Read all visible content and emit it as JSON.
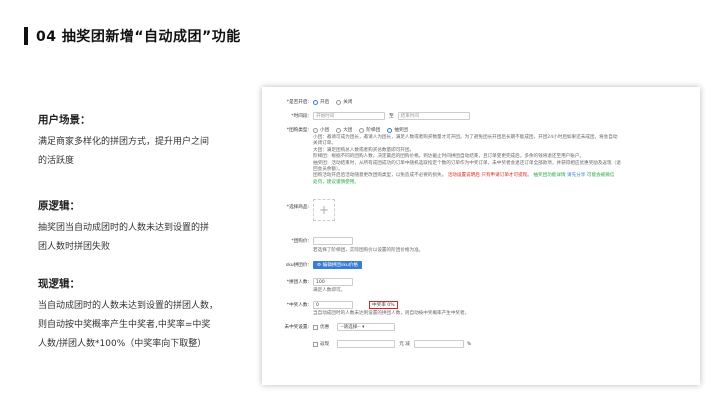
{
  "header": {
    "title": "04 抽奖团新增“自动成团”功能"
  },
  "left": {
    "sec1_title": "用户场景：",
    "sec1_lines": [
      "满足商家多样化的拼团方式，提升用户之间",
      "的活跃度"
    ],
    "sec2_title": "原逻辑：",
    "sec2_lines": [
      "抽奖团当自动成团时的人数未达到设置的拼",
      "团人数时拼团失败"
    ],
    "sec3_title": "现逻辑：",
    "sec3_lines": [
      "当自动成团时的人数未达到设置的拼团人数，",
      "则自动按中奖概率产生中奖者,中奖率=中奖",
      "人数/拼团人数*100%（中奖率向下取整）"
    ]
  },
  "form": {
    "open_label": "*是否开启:",
    "open_on": "开启",
    "open_off": "关闭",
    "time_label": "*时间段:",
    "time_start": "开始时间",
    "time_to": "至",
    "time_end": "结束时间",
    "type_label": "*团购类型:",
    "type_options": [
      "小团",
      "大团",
      "阶梯团",
      "抽奖团"
    ],
    "type_desc": [
      "小团：邀请可成为团长，邀请人为团长，满足人数或者购买数量才可开团。为了避免团长开团后长期不能成团，开团24小时后如果还未成团，将会自动",
      "关闭订单。",
      "大团：满足团购总人数或者购买总数量即可开团。",
      "阶梯团：根据不同的团购人数，决定最后的团购价格。到达截止时间拼团自动结束，且订单变更完成后，多余的钱将退还至用户账户。",
      "抽奖团：活动结束时，从所有成团成功的订单中随机选取指定个数的订单作为中奖订单，未中奖者会退还订单全部款项，并获得相应优惠奖励及返现（退",
      "回会员余额）。"
    ],
    "type_note_plain": "团购活动开启后活动随意更改团购类型，以免造成不必要的损失。",
    "type_note_red1": "活动设置说明后",
    "type_note_red2": "只有申请订单才可提现",
    "type_note_mid": "。",
    "type_note_green1": "抽奖团功能详情",
    "type_note_blue": "请先分享",
    "type_note_green2": "可能会被微信",
    "type_note_green3": "处罚，建议谨慎使用。",
    "goods_label": "*选择商品:",
    "price_label": "*团购价:",
    "price_hint": "若选择了阶梯团，实际团购价以设置的阶团价格为准。",
    "sku_label": "sku拼团价:",
    "sku_button": "编辑拼团sku价格",
    "people_label": "*拼团人数:",
    "people_value": "100",
    "people_hint": "满足人数即可。",
    "winners_label": "*中奖人数:",
    "winners_value": "0",
    "rate_label": "中奖率",
    "rate_value": "0%",
    "winners_hint": "当自动成团时的人数未达到设置的拼团人数，则自动按中奖概率产生中奖者。",
    "setting_label": "未中奖设置:",
    "coupon_label": "优惠",
    "coupon_select": "--请选择--",
    "cashback_label": "返现",
    "cashback_to": "元 减",
    "cashback_pct": "%"
  },
  "colors": {
    "accent": "#3a7bd5",
    "danger": "#e0261b",
    "success": "#2aa745"
  }
}
